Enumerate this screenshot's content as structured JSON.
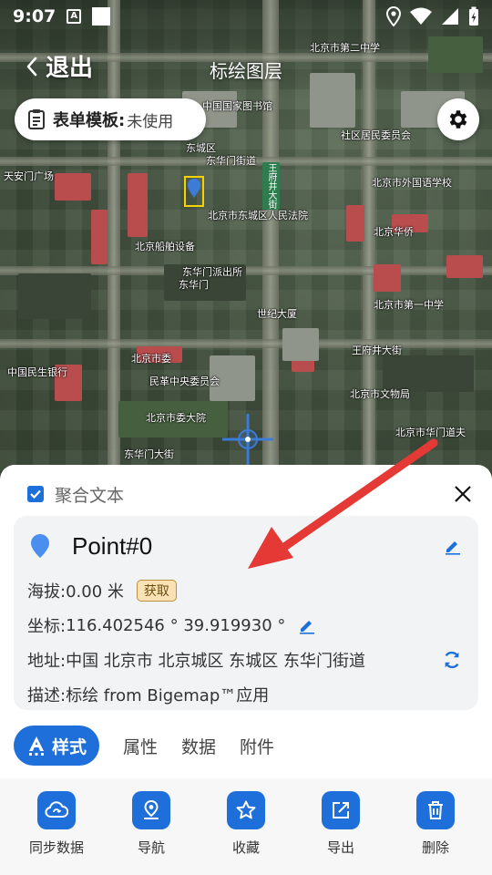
{
  "status_bar": {
    "time": "9:07",
    "a_icon_text": "A",
    "icons": [
      "location-icon",
      "wifi-icon",
      "signal-icon",
      "battery-charging-icon"
    ]
  },
  "nav": {
    "back_label": "退出",
    "title": "标绘图层"
  },
  "template": {
    "label": "表单模板:",
    "value": "未使用"
  },
  "map_labels": [
    "中国国家图书馆",
    "东城区",
    "北京市第二中学",
    "北京市外国语学校",
    "北京船舶设备",
    "东华门街道",
    "北京华侨",
    "天安门广场",
    "东华门派出所",
    "东华门",
    "北京市委",
    "世纪大厦",
    "北京市第一中学",
    "民革中央委员会",
    "北京市委大院",
    "社区居民委员会",
    "王府井大街",
    "东华门大街",
    "中国民生银行",
    "北京市文物局",
    "北京市东城区人民法院",
    "北京市华门道夫"
  ],
  "sheet": {
    "aggregate_label": "聚合文本",
    "point_name": "Point#0",
    "altitude_key": "海拔:",
    "altitude_value": "0.00 米",
    "fetch_label": "获取",
    "coord_key": "坐标:",
    "coord_value": "116.402546 °  39.919930 °",
    "address_key": "地址:",
    "address_value": "中国 北京市 北京城区 东城区 东华门街道",
    "desc_key": "描述:",
    "desc_value": "标绘 from Bigemap™应用"
  },
  "tabs": [
    {
      "label": "样式",
      "icon": "text-style-icon",
      "active": true
    },
    {
      "label": "属性",
      "active": false
    },
    {
      "label": "数据",
      "active": false
    },
    {
      "label": "附件",
      "active": false
    }
  ],
  "actions": [
    {
      "label": "同步数据",
      "icon": "cloud-sync-icon"
    },
    {
      "label": "导航",
      "icon": "navigation-pin-icon"
    },
    {
      "label": "收藏",
      "icon": "star-icon"
    },
    {
      "label": "导出",
      "icon": "export-icon"
    },
    {
      "label": "删除",
      "icon": "trash-icon"
    }
  ],
  "colors": {
    "accent": "#1e6fd9",
    "fetch_bg": "#fbe2b4",
    "arrow": "#e53935",
    "marker_border": "#f5d300"
  }
}
